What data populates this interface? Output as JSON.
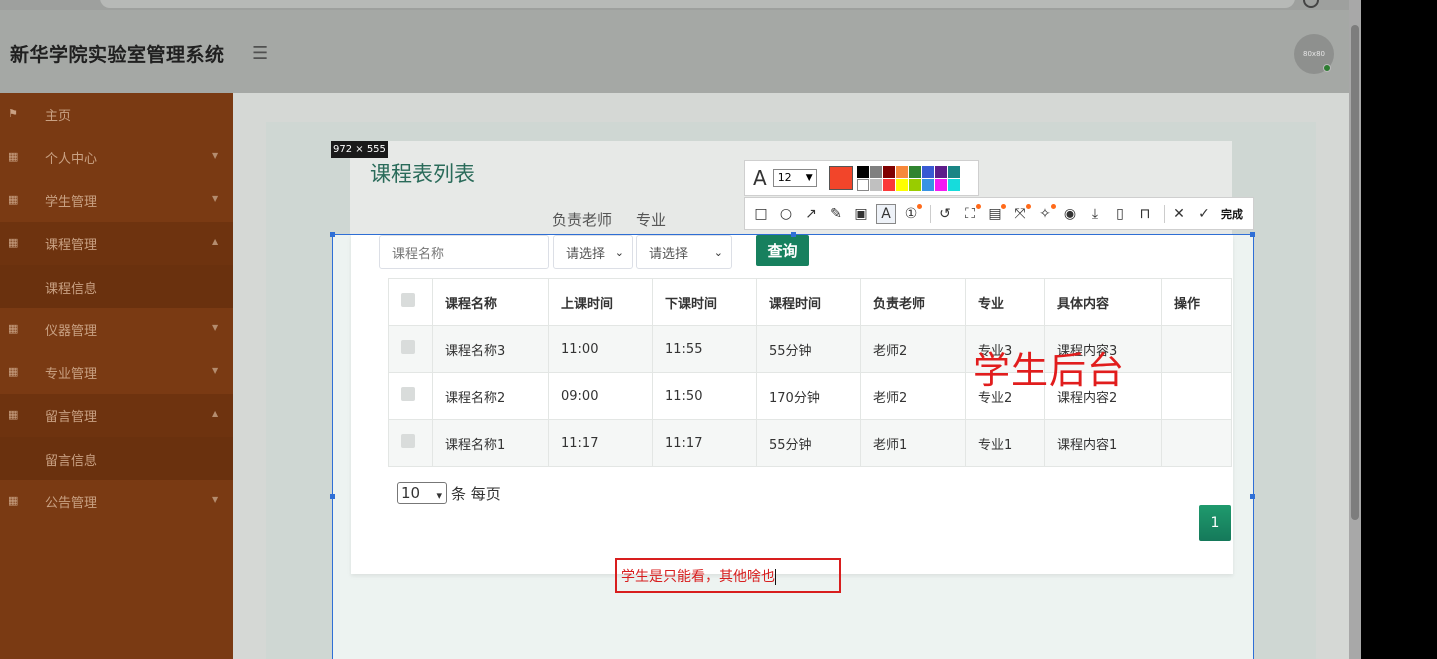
{
  "app": {
    "title": "新华学院实验室管理系统",
    "avatar_text": "80x80"
  },
  "sidebar": {
    "items": [
      {
        "label": "主页",
        "icon": "flag-icon"
      },
      {
        "label": "个人中心",
        "icon": "grid-icon"
      },
      {
        "label": "学生管理",
        "icon": "grid-icon"
      },
      {
        "label": "课程管理",
        "icon": "grid-icon"
      },
      {
        "label": "课程信息"
      },
      {
        "label": "仪器管理",
        "icon": "grid-icon"
      },
      {
        "label": "专业管理",
        "icon": "grid-icon"
      },
      {
        "label": "留言管理",
        "icon": "grid-icon"
      },
      {
        "label": "留言信息"
      },
      {
        "label": "公告管理",
        "icon": "grid-icon"
      }
    ]
  },
  "snip": {
    "dimensions": "972 × 555",
    "font_size": "12",
    "current_color": "#f2452a",
    "palette": [
      "#000000",
      "#808080",
      "#800000",
      "#f7883a",
      "#308430",
      "#385ad3",
      "#5d1d8a",
      "#1a8585",
      "#ffffff",
      "#c0c0c0",
      "#fb3838",
      "#ffff00",
      "#99cc00",
      "#3894e4",
      "#f31bf3",
      "#16dcdc"
    ],
    "done_label": "完成"
  },
  "page": {
    "title": "课程表列表",
    "filter_labels": {
      "teacher": "负责老师",
      "major": "专业"
    },
    "search": {
      "placeholder": "课程名称",
      "teacher_select": "请选择",
      "major_select": "请选择",
      "button": "查询"
    },
    "table": {
      "headers": [
        "课程名称",
        "上课时间",
        "下课时间",
        "课程时间",
        "负责老师",
        "专业",
        "具体内容",
        "操作"
      ],
      "rows": [
        [
          "课程名称3",
          "11:00",
          "11:55",
          "55分钟",
          "老师2",
          "专业3",
          "课程内容3",
          ""
        ],
        [
          "课程名称2",
          "09:00",
          "11:50",
          "170分钟",
          "老师2",
          "专业2",
          "课程内容2",
          ""
        ],
        [
          "课程名称1",
          "11:17",
          "11:17",
          "55分钟",
          "老师1",
          "专业1",
          "课程内容1",
          ""
        ]
      ]
    },
    "per_page": {
      "value": "10",
      "suffix": "条 每页"
    },
    "pagination": {
      "current": "1"
    }
  },
  "annotations": {
    "big_text": "学生后台",
    "note_text": "学生是只能看，其他啥也"
  }
}
